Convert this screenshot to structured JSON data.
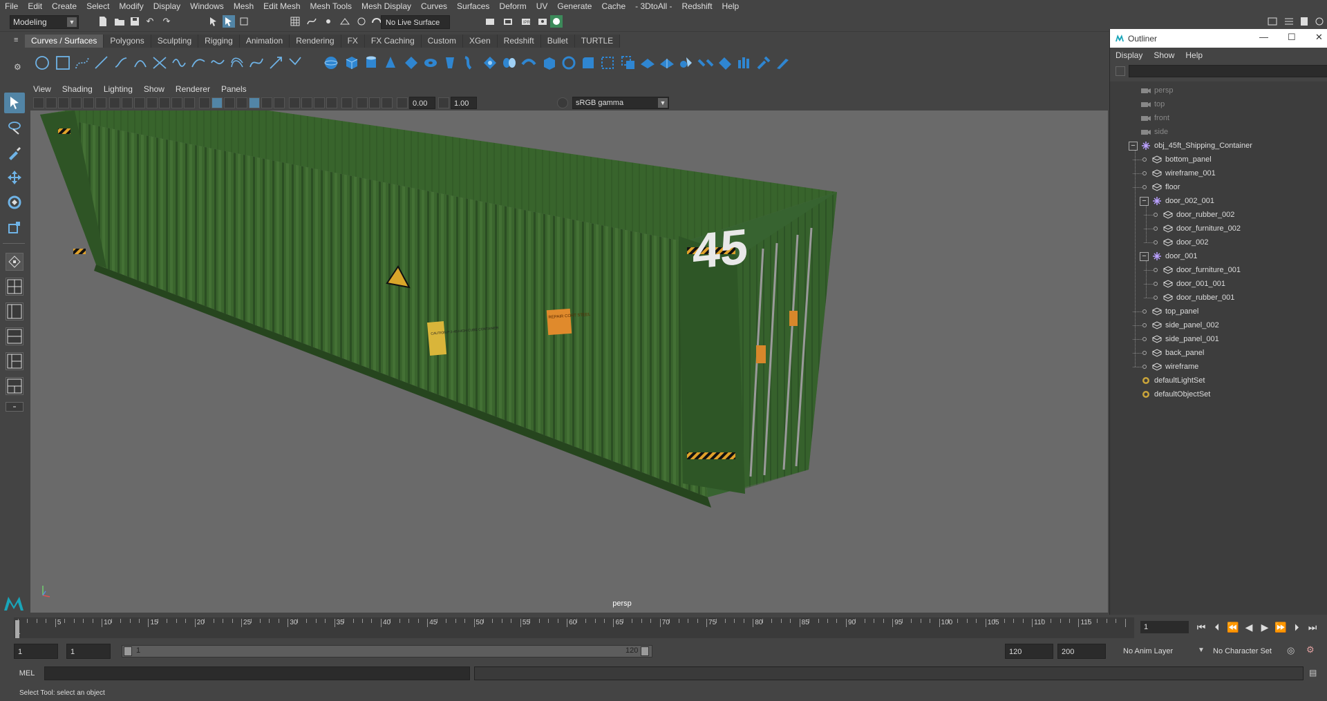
{
  "menubar": {
    "items": [
      "File",
      "Edit",
      "Create",
      "Select",
      "Modify",
      "Display",
      "Windows",
      "Mesh",
      "Edit Mesh",
      "Mesh Tools",
      "Mesh Display",
      "Curves",
      "Surfaces",
      "Deform",
      "UV",
      "Generate",
      "Cache",
      "- 3DtoAll -",
      "Redshift",
      "Help"
    ]
  },
  "statusline": {
    "mode": "Modeling",
    "live_surface": "No Live Surface"
  },
  "shelf": {
    "tabs": [
      "Curves / Surfaces",
      "Polygons",
      "Sculpting",
      "Rigging",
      "Animation",
      "Rendering",
      "FX",
      "FX Caching",
      "Custom",
      "XGen",
      "Redshift",
      "Bullet",
      "TURTLE"
    ],
    "active_tab": "Curves / Surfaces"
  },
  "viewport": {
    "menu": [
      "View",
      "Shading",
      "Lighting",
      "Show",
      "Renderer",
      "Panels"
    ],
    "exposure": "0.00",
    "gamma": "1.00",
    "color_space": "sRGB gamma",
    "camera_label": "persp",
    "container_number": "45",
    "sticker1_text": "CAUTION P 2-45 HIGH CUBE CONTAINER",
    "sticker2_text": "REPAIR CORT STEEL"
  },
  "outliner": {
    "title": "Outliner",
    "menu": [
      "Display",
      "Show",
      "Help"
    ],
    "items": [
      {
        "label": "persp",
        "kind": "camera",
        "depth": 0,
        "dim": true
      },
      {
        "label": "top",
        "kind": "camera",
        "depth": 0,
        "dim": true
      },
      {
        "label": "front",
        "kind": "camera",
        "depth": 0,
        "dim": true
      },
      {
        "label": "side",
        "kind": "camera",
        "depth": 0,
        "dim": true
      },
      {
        "label": "obj_45ft_Shipping_Container",
        "kind": "group",
        "depth": 0,
        "expanded": true
      },
      {
        "label": "bottom_panel",
        "kind": "mesh",
        "depth": 1
      },
      {
        "label": "wireframe_001",
        "kind": "mesh",
        "depth": 1
      },
      {
        "label": "floor",
        "kind": "mesh",
        "depth": 1
      },
      {
        "label": "door_002_001",
        "kind": "group",
        "depth": 1,
        "expanded": true
      },
      {
        "label": "door_rubber_002",
        "kind": "mesh",
        "depth": 2
      },
      {
        "label": "door_furniture_002",
        "kind": "mesh",
        "depth": 2
      },
      {
        "label": "door_002",
        "kind": "mesh",
        "depth": 2
      },
      {
        "label": "door_001",
        "kind": "group",
        "depth": 1,
        "expanded": true
      },
      {
        "label": "door_furniture_001",
        "kind": "mesh",
        "depth": 2
      },
      {
        "label": "door_001_001",
        "kind": "mesh",
        "depth": 2
      },
      {
        "label": "door_rubber_001",
        "kind": "mesh",
        "depth": 2
      },
      {
        "label": "top_panel",
        "kind": "mesh",
        "depth": 1
      },
      {
        "label": "side_panel_002",
        "kind": "mesh",
        "depth": 1
      },
      {
        "label": "side_panel_001",
        "kind": "mesh",
        "depth": 1
      },
      {
        "label": "back_panel",
        "kind": "mesh",
        "depth": 1
      },
      {
        "label": "wireframe",
        "kind": "mesh",
        "depth": 1
      },
      {
        "label": "defaultLightSet",
        "kind": "set",
        "depth": 0
      },
      {
        "label": "defaultObjectSet",
        "kind": "set",
        "depth": 0
      }
    ]
  },
  "timeslider": {
    "ticks": [
      "5",
      "10",
      "15",
      "20",
      "25",
      "30",
      "35",
      "40",
      "45",
      "50",
      "55",
      "60",
      "65",
      "70",
      "75",
      "80",
      "85",
      "90",
      "95",
      "100",
      "105",
      "110",
      "115"
    ],
    "start_tick": "1",
    "current_frame": "1"
  },
  "range": {
    "start": "1",
    "playback_start": "1",
    "slider_start": "1",
    "slider_end": "120",
    "playback_end": "120",
    "end": "200",
    "anim_layer": "No Anim Layer",
    "character_set": "No Character Set"
  },
  "cmdline": {
    "label": "MEL",
    "help": "Select Tool: select an object"
  },
  "colors": {
    "accent": "#5285a6",
    "container_green": "#3d6b2e",
    "viewport_bg": "#6a6a6a"
  }
}
